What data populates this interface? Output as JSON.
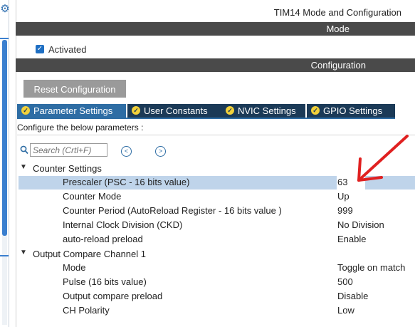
{
  "title": "TIM14 Mode and Configuration",
  "mode_section": {
    "label": "Mode",
    "activated_label": "Activated",
    "activated_checked": true
  },
  "configuration_section": {
    "label": "Configuration"
  },
  "reset_button": "Reset Configuration",
  "tabs": [
    {
      "label": "Parameter Settings",
      "active": true
    },
    {
      "label": "User Constants",
      "active": false
    },
    {
      "label": "NVIC Settings",
      "active": false
    },
    {
      "label": "GPIO Settings",
      "active": false
    }
  ],
  "configure_text": "Configure the below parameters :",
  "search": {
    "placeholder": "Search (Crtl+F)"
  },
  "groups": [
    {
      "label": "Counter Settings",
      "params": [
        {
          "name": "Prescaler (PSC - 16 bits value)",
          "value": "63"
        },
        {
          "name": "Counter Mode",
          "value": "Up"
        },
        {
          "name": "Counter Period (AutoReload Register - 16 bits value )",
          "value": "999"
        },
        {
          "name": "Internal Clock Division (CKD)",
          "value": "No Division"
        },
        {
          "name": "auto-reload preload",
          "value": "Enable"
        }
      ]
    },
    {
      "label": "Output Compare Channel 1",
      "params": [
        {
          "name": "Mode",
          "value": "Toggle on match"
        },
        {
          "name": "Pulse (16 bits value)",
          "value": "500"
        },
        {
          "name": "Output compare preload",
          "value": "Disable"
        },
        {
          "name": "CH Polarity",
          "value": "Low"
        }
      ]
    }
  ],
  "colors": {
    "accent": "#2e6da4",
    "tab_inactive": "#1b3a57",
    "section_bar": "#4a4a4a",
    "annotation": "#e02020",
    "selected_row": "#bfd4ea"
  },
  "icons": {
    "settings": "gear-icon",
    "search": "search-icon",
    "prev": "chevron-left-icon",
    "next": "chevron-right-icon",
    "tab_check": "check-circle-icon"
  }
}
